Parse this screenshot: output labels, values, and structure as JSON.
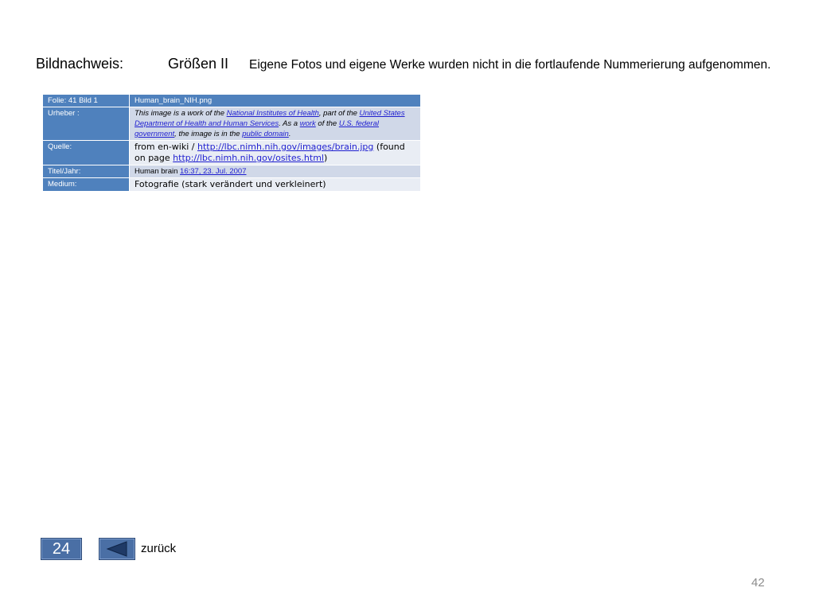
{
  "header": {
    "title": "Bildnachweis:",
    "subtitle": "Größen II",
    "note": "Eigene Fotos und eigene Werke wurden nicht in die fortlaufende Nummerierung aufgenommen."
  },
  "credits": {
    "row0": {
      "label": "Folie: 41 Bild 1",
      "value": "Human_brain_NIH.png"
    },
    "row1": {
      "label": "Urheber :",
      "t1": "This image is a work of the ",
      "l1": "National Institutes of Health",
      "t2": ", part of the ",
      "l2": "United States Department of Health and Human Services",
      "t3": ". As a ",
      "l3": "work",
      "t4": " of the ",
      "l4": "U.S. federal government",
      "t5": ", the image is in the ",
      "l5": "public domain",
      "t6": "."
    },
    "row2": {
      "label": "Quelle:",
      "t1": "from en-wiki / ",
      "l1": "http://lbc.nimh.nih.gov/images/brain.jpg",
      "t2": " (found on page ",
      "l2": "http://lbc.nimh.nih.gov/osites.html",
      "t3": ")"
    },
    "row3": {
      "label": "Titel/Jahr:",
      "t1": "Human brain ",
      "l1": "16:37, 23. Jul. 2007"
    },
    "row4": {
      "label": "Medium:",
      "value": "Fotografie (stark verändert und verkleinert)"
    }
  },
  "nav": {
    "slide_number": "24",
    "back_label": "zurück"
  },
  "page_number": "42",
  "colors": {
    "accent": "#4f81bd",
    "button": "#4a6fa5"
  }
}
